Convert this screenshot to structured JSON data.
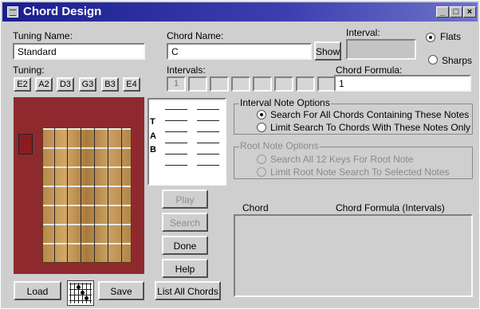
{
  "window": {
    "title": "Chord Design"
  },
  "tuning_name": {
    "label": "Tuning Name:",
    "value": "Standard"
  },
  "tuning": {
    "label": "Tuning:",
    "strings": [
      "E2",
      "A2",
      "D3",
      "G3",
      "B3",
      "E4"
    ]
  },
  "chord_name": {
    "label": "Chord Name:",
    "value": "C",
    "show_label": "Show"
  },
  "interval": {
    "label": "Interval:",
    "value": ""
  },
  "accidentals": {
    "flats_label": "Flats",
    "sharps_label": "Sharps",
    "selected": "Flats"
  },
  "intervals": {
    "label": "Intervals:",
    "values": [
      "1",
      "",
      "",
      "",
      "",
      "",
      "",
      ""
    ]
  },
  "chord_formula": {
    "label": "Chord Formula:",
    "value": "1"
  },
  "tab_letters": [
    "T",
    "A",
    "B"
  ],
  "interval_note_options": {
    "title": "Interval Note Options",
    "options": [
      "Search For All Chords Containing These Notes",
      "Limit Search To Chords With These Notes Only"
    ],
    "selected": 0
  },
  "root_note_options": {
    "title": "Root Note Options",
    "options": [
      "Search All 12 Keys For Root Note",
      "Limit Root Note Search To Selected Notes"
    ],
    "enabled": false
  },
  "buttons": {
    "play": "Play",
    "search": "Search",
    "done": "Done",
    "help": "Help",
    "list_all": "List All Chords",
    "load": "Load",
    "save": "Save"
  },
  "results": {
    "col_chord": "Chord",
    "col_formula": "Chord Formula (Intervals)"
  },
  "colors": {
    "title_bar": "#1a1f8c",
    "fretboard_bg": "#8e2a2e",
    "window_bg": "#cfcfcf"
  },
  "icons": [
    "app-icon",
    "minimize-icon",
    "maximize-icon",
    "close-icon",
    "chord-grid-icon"
  ]
}
